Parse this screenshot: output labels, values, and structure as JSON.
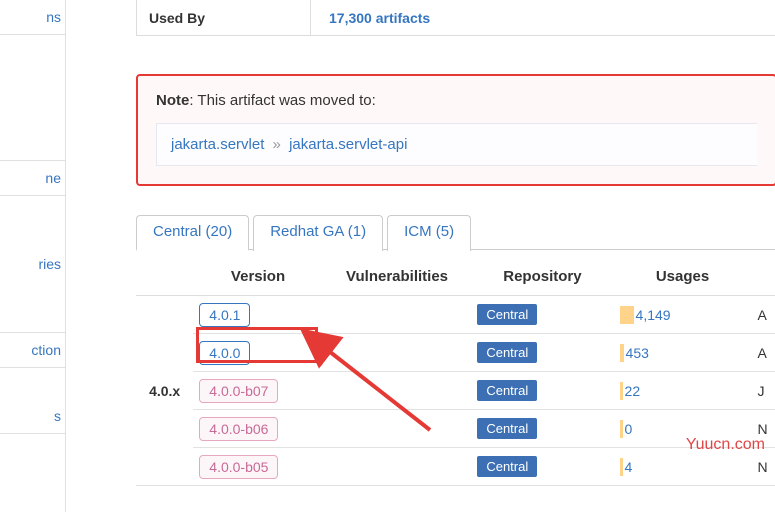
{
  "sidebar": {
    "items": [
      {
        "label": "ns"
      },
      {
        "label": ""
      },
      {
        "label": "ne"
      },
      {
        "label": "ries"
      },
      {
        "label": "ction"
      },
      {
        "label": "s"
      }
    ]
  },
  "info": {
    "usedby_label": "Used By",
    "usedby_value": "17,300 artifacts"
  },
  "note": {
    "prefix": "Note",
    "text": ": This artifact was moved to:",
    "crumb1": "jakarta.servlet",
    "sep": "»",
    "crumb2": "jakarta.servlet-api"
  },
  "tabs": [
    {
      "label": "Central (20)"
    },
    {
      "label": "Redhat GA (1)"
    },
    {
      "label": "ICM (5)"
    }
  ],
  "table": {
    "headers": {
      "group": "",
      "version": "Version",
      "vuln": "Vulnerabilities",
      "repo": "Repository",
      "usages": "Usages",
      "date": ""
    },
    "group_label": "4.0.x",
    "rows": [
      {
        "version": "4.0.1",
        "faded": false,
        "repo": "Central",
        "usages": "4,149",
        "bar": 14,
        "date": "A"
      },
      {
        "version": "4.0.0",
        "faded": false,
        "repo": "Central",
        "usages": "453",
        "bar": 4,
        "date": "A"
      },
      {
        "version": "4.0.0-b07",
        "faded": true,
        "repo": "Central",
        "usages": "22",
        "bar": 3,
        "date": "J"
      },
      {
        "version": "4.0.0-b06",
        "faded": true,
        "repo": "Central",
        "usages": "0",
        "bar": 3,
        "date": "N"
      },
      {
        "version": "4.0.0-b05",
        "faded": true,
        "repo": "Central",
        "usages": "4",
        "bar": 3,
        "date": "N"
      }
    ]
  },
  "watermark": "Yuucn.com"
}
